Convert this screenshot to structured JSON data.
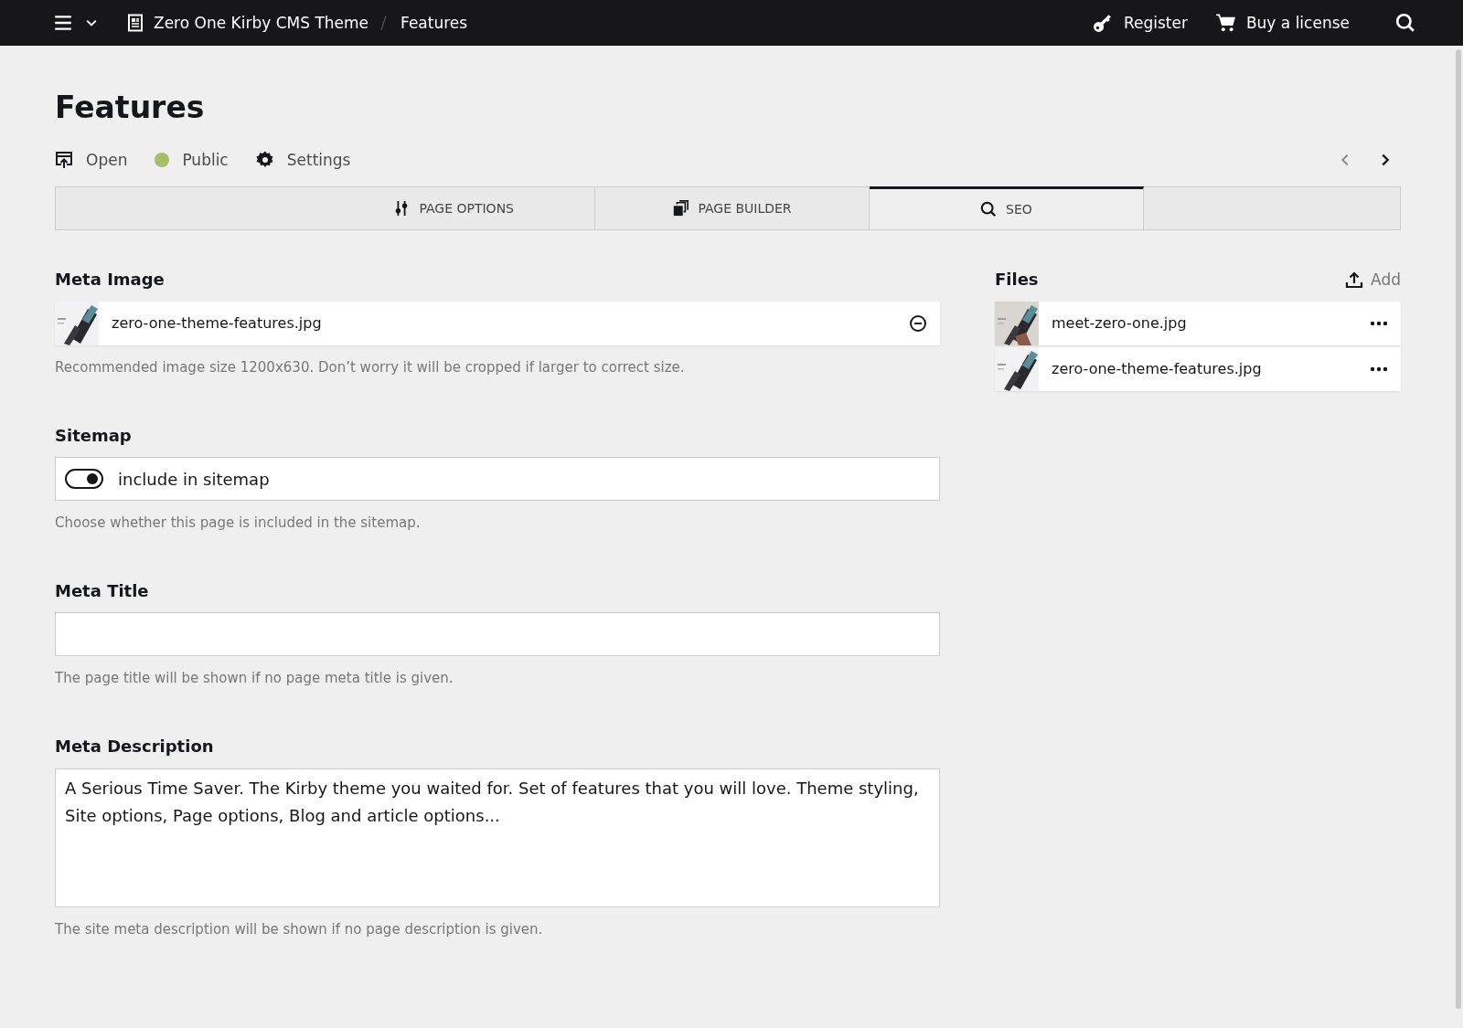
{
  "topbar": {
    "breadcrumbs": [
      "Zero One Kirby CMS Theme",
      "Features"
    ],
    "actions": [
      {
        "kind": "register",
        "label": "Register"
      },
      {
        "kind": "buy",
        "label": "Buy a license"
      }
    ]
  },
  "page": {
    "title": "Features",
    "options": [
      {
        "kind": "open",
        "label": "Open"
      },
      {
        "kind": "status",
        "label": "Public",
        "color": "#a7bd68"
      },
      {
        "kind": "settings",
        "label": "Settings"
      }
    ]
  },
  "tabs": [
    {
      "kind": "options",
      "label": "PAGE OPTIONS",
      "selected": false
    },
    {
      "kind": "builder",
      "label": "PAGE BUILDER",
      "selected": false
    },
    {
      "kind": "seo",
      "label": "SEO",
      "selected": true
    }
  ],
  "meta_image": {
    "label": "Meta Image",
    "file": "zero-one-theme-features.jpg",
    "help": "Recommended image size 1200x630. Don’t worry it will be cropped if larger to correct size."
  },
  "sitemap": {
    "label": "Sitemap",
    "toggle_label": "include in sitemap",
    "on": true,
    "help": "Choose whether this page is included in the sitemap."
  },
  "meta_title": {
    "label": "Meta Title",
    "help": "The page title will be shown if no page meta title is given."
  },
  "meta_description": {
    "label": "Meta Description",
    "value": "A Serious Time Saver. The Kirby theme you waited for. Set of features that you will love. Theme styling, Site options, Page options, Blog and article options...",
    "help": "The site meta description will be shown if no page description is given."
  },
  "files": {
    "label": "Files",
    "add": "Add",
    "items": [
      {
        "name": "meet-zero-one.jpg"
      },
      {
        "name": "zero-one-theme-features.jpg"
      }
    ]
  }
}
